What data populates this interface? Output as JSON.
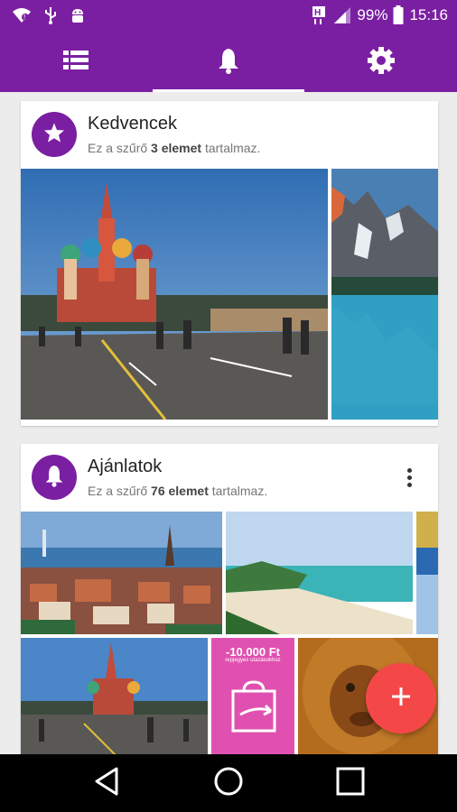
{
  "status_bar": {
    "battery_percent": "99%",
    "time": "15:16",
    "icons": [
      "wifi-icon",
      "usb-icon",
      "android-debug-icon",
      "h-signal-icon",
      "cell-signal-icon",
      "battery-icon"
    ]
  },
  "tabs": [
    {
      "icon": "list-icon",
      "active": false
    },
    {
      "icon": "bell-icon",
      "active": true
    },
    {
      "icon": "gear-icon",
      "active": false
    }
  ],
  "cards": [
    {
      "title": "Kedvencek",
      "icon": "star-icon",
      "sub_prefix": "Ez a szűrő ",
      "sub_count": "3 elemet",
      "sub_suffix": " tartalmaz."
    },
    {
      "title": "Ajánlatok",
      "icon": "bell-icon",
      "sub_prefix": "Ez a szűrő ",
      "sub_count": "76 elemet",
      "sub_suffix": " tartalmaz."
    }
  ],
  "promo": {
    "price": "-10.000 Ft",
    "subtitle": "repjegyes utazásokhoz"
  },
  "colors": {
    "primary": "#7b1fa2",
    "fab": "#f44848",
    "promo": "#e050b0"
  }
}
